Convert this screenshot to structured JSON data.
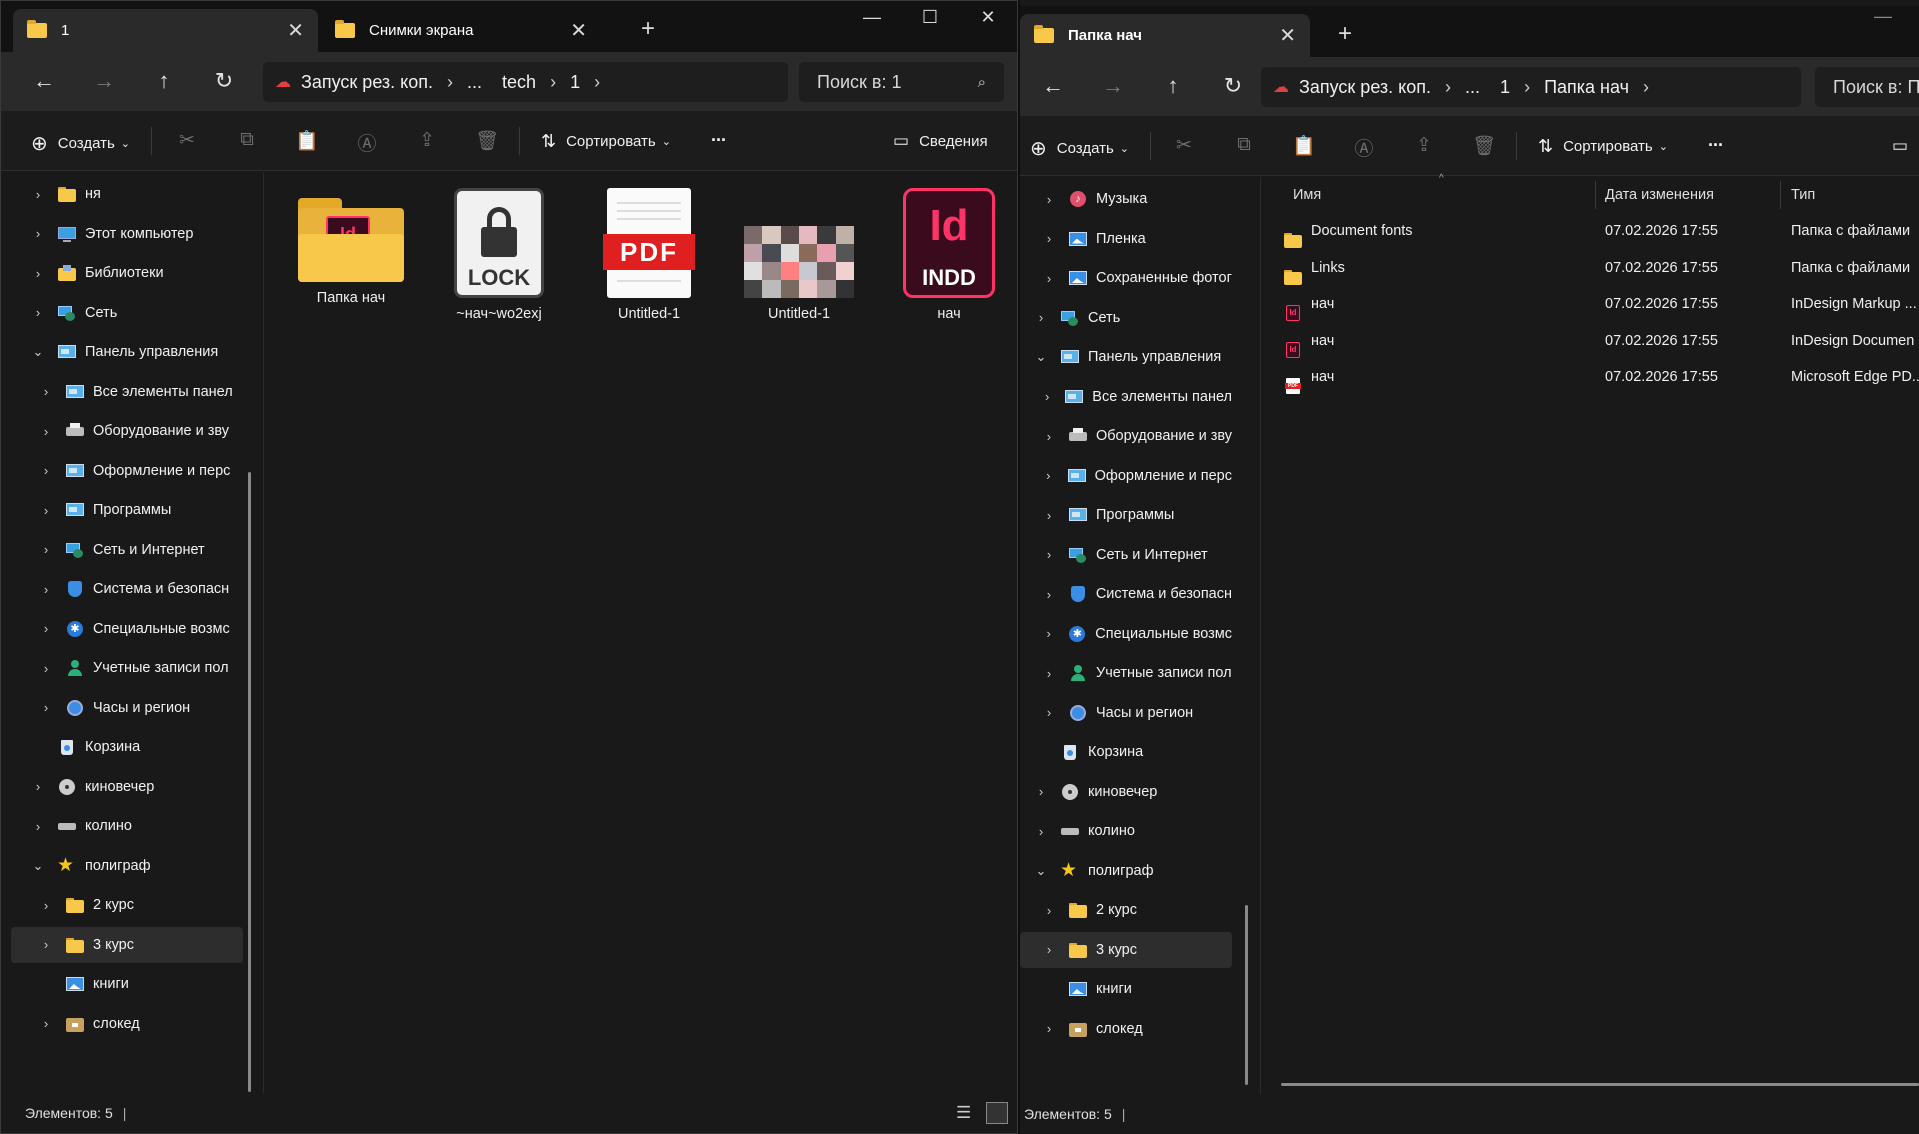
{
  "left": {
    "tabs": [
      {
        "label": "1",
        "active": true
      },
      {
        "label": "Снимки экрана",
        "active": false
      }
    ],
    "address": {
      "root": "Запуск рез. коп.",
      "crumbs": [
        "...",
        "tech",
        "1"
      ]
    },
    "search_placeholder": "Поиск в: 1",
    "toolbar": {
      "create": "Создать",
      "sort": "Сортировать",
      "more": "...",
      "details": "Сведения"
    },
    "sidebar": [
      {
        "label": "ня",
        "icon": "folder-icon",
        "level": 0,
        "expand": "collapsed"
      },
      {
        "label": "Этот компьютер",
        "icon": "computer-icon",
        "level": 0,
        "expand": "collapsed"
      },
      {
        "label": "Библиотеки",
        "icon": "library-icon",
        "level": 0,
        "expand": "collapsed"
      },
      {
        "label": "Сеть",
        "icon": "network-icon",
        "level": 0,
        "expand": "collapsed"
      },
      {
        "label": "Панель управления",
        "icon": "control-panel-icon",
        "level": 0,
        "expand": "expanded"
      },
      {
        "label": "Все элементы панел",
        "icon": "control-panel-icon",
        "level": 1,
        "expand": "collapsed"
      },
      {
        "label": "Оборудование и зву",
        "icon": "printer-icon",
        "level": 1,
        "expand": "collapsed"
      },
      {
        "label": "Оформление и перс",
        "icon": "display-icon",
        "level": 1,
        "expand": "collapsed"
      },
      {
        "label": "Программы",
        "icon": "programs-icon",
        "level": 1,
        "expand": "collapsed"
      },
      {
        "label": "Сеть и Интернет",
        "icon": "network-internet-icon",
        "level": 1,
        "expand": "collapsed"
      },
      {
        "label": "Система и безопасн",
        "icon": "shield-icon",
        "level": 1,
        "expand": "collapsed"
      },
      {
        "label": "Специальные возмс",
        "icon": "accessibility-icon",
        "level": 1,
        "expand": "collapsed"
      },
      {
        "label": "Учетные записи пол",
        "icon": "user-icon",
        "level": 1,
        "expand": "collapsed"
      },
      {
        "label": "Часы и регион",
        "icon": "clock-globe-icon",
        "level": 1,
        "expand": "collapsed"
      },
      {
        "label": "Корзина",
        "icon": "recycle-bin-icon",
        "level": 0,
        "expand": "none"
      },
      {
        "label": "киновечер",
        "icon": "disc-icon",
        "level": 0,
        "expand": "collapsed"
      },
      {
        "label": "колино",
        "icon": "drive-icon",
        "level": 0,
        "expand": "collapsed"
      },
      {
        "label": "полиграф",
        "icon": "star-icon",
        "level": 0,
        "expand": "expanded"
      },
      {
        "label": "2 курс",
        "icon": "folder-icon",
        "level": 1,
        "expand": "collapsed"
      },
      {
        "label": "3 курс",
        "icon": "folder-icon",
        "level": 1,
        "expand": "collapsed",
        "selected": true
      },
      {
        "label": "книги",
        "icon": "image-icon",
        "level": 1,
        "expand": "none"
      },
      {
        "label": "слокед",
        "icon": "box-folder-icon",
        "level": 1,
        "expand": "collapsed"
      }
    ],
    "files": [
      {
        "name": "Папка нач",
        "icon": "indesign-folder-icon"
      },
      {
        "name": "~нач~wo2exj",
        "icon": "lock-file-icon",
        "badge": "LOCK"
      },
      {
        "name": "Untitled-1",
        "icon": "pdf-file-icon",
        "badge": "PDF"
      },
      {
        "name": "Untitled-1",
        "icon": "image-thumbnail-icon"
      },
      {
        "name": "нач",
        "icon": "indd-file-icon",
        "badge": "INDD"
      }
    ],
    "status": "Элементов: 5"
  },
  "right": {
    "tabs": [
      {
        "label": "Папка нач",
        "active": true
      }
    ],
    "address": {
      "root": "Запуск рез. коп.",
      "crumbs": [
        "...",
        "1",
        "Папка нач"
      ]
    },
    "search_placeholder": "Поиск в: Папка нач",
    "toolbar": {
      "create": "Создать",
      "sort": "Сортировать",
      "more": "..."
    },
    "sidebar": [
      {
        "label": "Музыка",
        "icon": "music-icon",
        "level": 1,
        "expand": "collapsed"
      },
      {
        "label": "Пленка",
        "icon": "image-icon",
        "level": 1,
        "expand": "collapsed"
      },
      {
        "label": "Сохраненные фотог",
        "icon": "image-icon",
        "level": 1,
        "expand": "collapsed"
      },
      {
        "label": "Сеть",
        "icon": "network-icon",
        "level": 0,
        "expand": "collapsed"
      },
      {
        "label": "Панель управления",
        "icon": "control-panel-icon",
        "level": 0,
        "expand": "expanded"
      },
      {
        "label": "Все элементы панел",
        "icon": "control-panel-icon",
        "level": 1,
        "expand": "collapsed"
      },
      {
        "label": "Оборудование и зву",
        "icon": "printer-icon",
        "level": 1,
        "expand": "collapsed"
      },
      {
        "label": "Оформление и перс",
        "icon": "display-icon",
        "level": 1,
        "expand": "collapsed"
      },
      {
        "label": "Программы",
        "icon": "programs-icon",
        "level": 1,
        "expand": "collapsed"
      },
      {
        "label": "Сеть и Интернет",
        "icon": "network-internet-icon",
        "level": 1,
        "expand": "collapsed"
      },
      {
        "label": "Система и безопасн",
        "icon": "shield-icon",
        "level": 1,
        "expand": "collapsed"
      },
      {
        "label": "Специальные возмс",
        "icon": "accessibility-icon",
        "level": 1,
        "expand": "collapsed"
      },
      {
        "label": "Учетные записи пол",
        "icon": "user-icon",
        "level": 1,
        "expand": "collapsed"
      },
      {
        "label": "Часы и регион",
        "icon": "clock-globe-icon",
        "level": 1,
        "expand": "collapsed"
      },
      {
        "label": "Корзина",
        "icon": "recycle-bin-icon",
        "level": 0,
        "expand": "none"
      },
      {
        "label": "киновечер",
        "icon": "disc-icon",
        "level": 0,
        "expand": "collapsed"
      },
      {
        "label": "колино",
        "icon": "drive-icon",
        "level": 0,
        "expand": "collapsed"
      },
      {
        "label": "полиграф",
        "icon": "star-icon",
        "level": 0,
        "expand": "expanded"
      },
      {
        "label": "2 курс",
        "icon": "folder-icon",
        "level": 1,
        "expand": "collapsed"
      },
      {
        "label": "3 курс",
        "icon": "folder-icon",
        "level": 1,
        "expand": "collapsed",
        "selected": true
      },
      {
        "label": "книги",
        "icon": "image-icon",
        "level": 1,
        "expand": "none"
      },
      {
        "label": "слокед",
        "icon": "box-folder-icon",
        "level": 1,
        "expand": "collapsed"
      }
    ],
    "columns": {
      "name": "Имя",
      "date": "Дата изменения",
      "type": "Тип"
    },
    "rows": [
      {
        "name": "Document fonts",
        "date": "07.02.2026 17:55",
        "type": "Папка с файлами",
        "icon": "folder-icon"
      },
      {
        "name": "Links",
        "date": "07.02.2026 17:55",
        "type": "Папка с файлами",
        "icon": "folder-icon"
      },
      {
        "name": "нач",
        "date": "07.02.2026 17:55",
        "type": "InDesign Markup ...",
        "icon": "indesign-icon"
      },
      {
        "name": "нач",
        "date": "07.02.2026 17:55",
        "type": "InDesign Documen",
        "icon": "indesign-icon"
      },
      {
        "name": "нач",
        "date": "07.02.2026 17:55",
        "type": "Microsoft Edge PD...",
        "icon": "pdf-icon"
      }
    ],
    "status": "Элементов: 5"
  },
  "colors": {
    "accent_indesign": "#ff3366",
    "folder": "#f8c84a",
    "pdf_red": "#e02020"
  }
}
